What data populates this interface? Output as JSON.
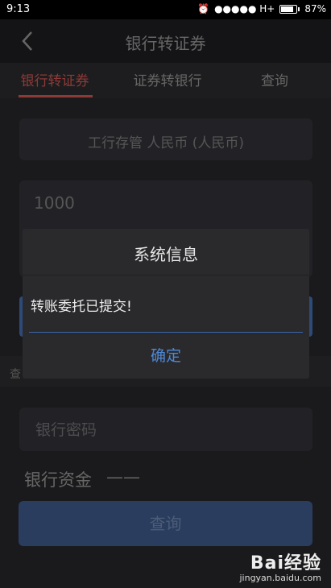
{
  "status_bar": {
    "time": "9:13",
    "network": "●●●●● H+",
    "battery": "87%"
  },
  "header": {
    "title": "银行转证券",
    "back_icon": "chevron-left-icon"
  },
  "tabs": [
    {
      "label": "银行转证券",
      "active": true
    },
    {
      "label": "证券转银行",
      "active": false
    },
    {
      "label": "查询",
      "active": false
    }
  ],
  "form": {
    "account": "工行存管 人民币 (人民币)",
    "amount": "1000",
    "section_label": "查",
    "password_placeholder": "银行密码",
    "funds_label": "银行资金",
    "funds_value": "——",
    "query_button": "查询"
  },
  "dialog": {
    "title": "系统信息",
    "message": "转账委托已提交!",
    "confirm": "确定"
  },
  "watermark": {
    "brand": "Bai经验",
    "url": "jingyan.baidu.com"
  },
  "colors": {
    "accent_red": "#8d3a37",
    "confirm_blue": "#4e88d6",
    "button_blue": "#2a3d5e"
  }
}
